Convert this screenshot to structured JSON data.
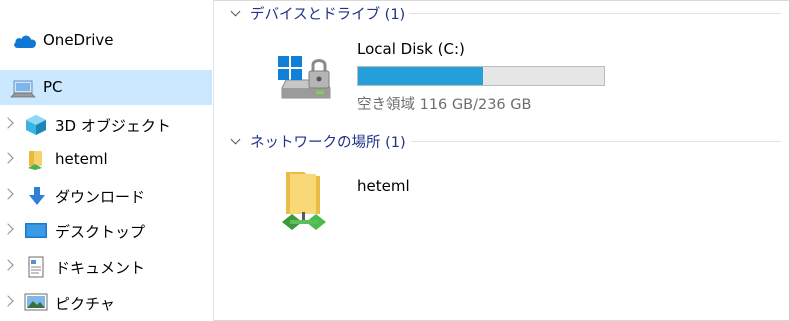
{
  "nav": {
    "items": [
      {
        "label": "OneDrive",
        "icon": "onedrive-cloud-icon",
        "expandable": false
      },
      {
        "label": "PC",
        "icon": "pc-icon",
        "expandable": false,
        "selected": true
      },
      {
        "label": "3D オブジェクト",
        "icon": "3d-objects-icon",
        "expandable": true
      },
      {
        "label": "heteml",
        "icon": "network-folder-icon",
        "expandable": true
      },
      {
        "label": "ダウンロード",
        "icon": "download-arrow-icon",
        "expandable": true
      },
      {
        "label": "デスクトップ",
        "icon": "desktop-icon",
        "expandable": true
      },
      {
        "label": "ドキュメント",
        "icon": "documents-icon",
        "expandable": true
      },
      {
        "label": "ピクチャ",
        "icon": "pictures-icon",
        "expandable": true
      }
    ]
  },
  "main": {
    "groups": [
      {
        "title": "デバイスとドライブ (1)"
      },
      {
        "title": "ネットワークの場所 (1)"
      }
    ],
    "drive": {
      "name": "Local Disk (C:)",
      "free_text": "空き領域 116 GB/236 GB",
      "used_fraction": 0.51,
      "bar_color": "#26a0da",
      "icon": "locked-drive-icon"
    },
    "network_location": {
      "name": "heteml",
      "icon": "network-folder-icon"
    }
  }
}
